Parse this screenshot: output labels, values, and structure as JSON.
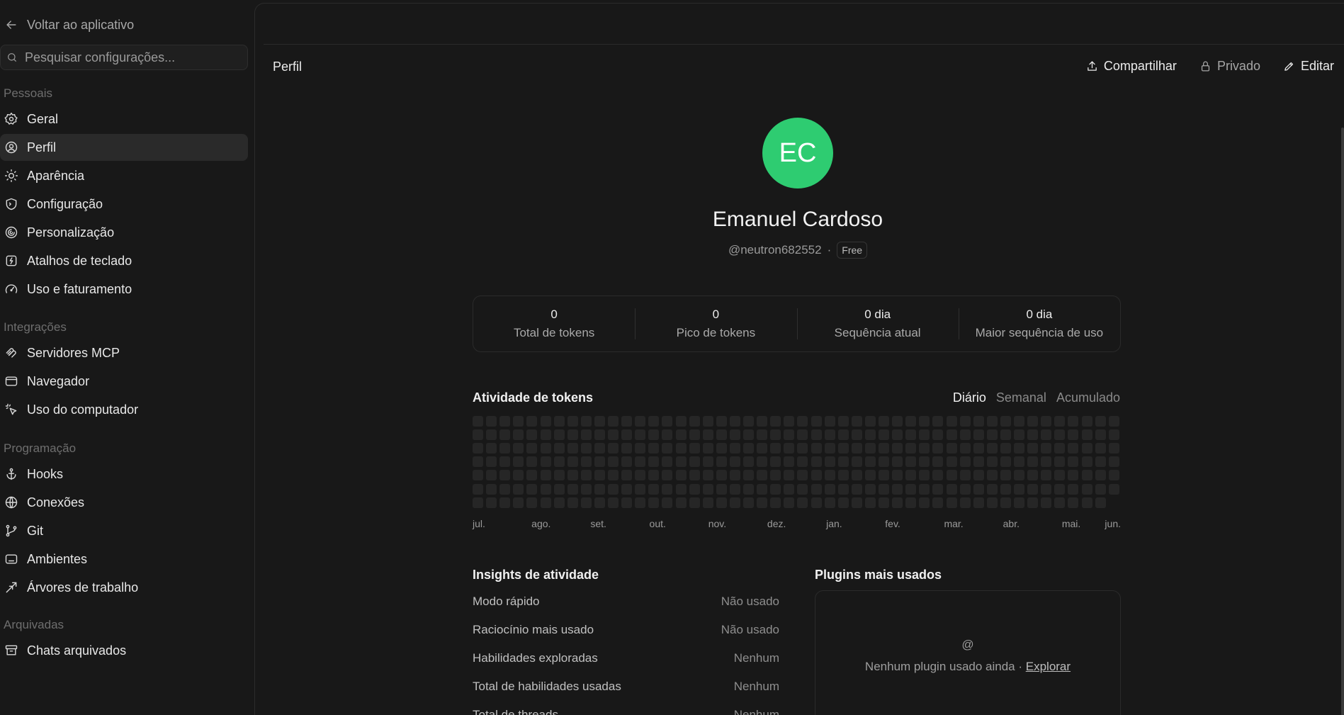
{
  "sidebar": {
    "back_label": "Voltar ao aplicativo",
    "search_placeholder": "Pesquisar configurações...",
    "sections": [
      {
        "title": "Pessoais",
        "items": [
          {
            "label": "Geral",
            "icon": "gear-icon"
          },
          {
            "label": "Perfil",
            "icon": "user-circle-icon",
            "active": true
          },
          {
            "label": "Aparência",
            "icon": "sun-icon"
          },
          {
            "label": "Configuração",
            "icon": "terminal-shield-icon"
          },
          {
            "label": "Personalização",
            "icon": "swirl-icon"
          },
          {
            "label": "Atalhos de teclado",
            "icon": "keyboard-shortcut-icon"
          },
          {
            "label": "Uso e faturamento",
            "icon": "gauge-icon"
          }
        ]
      },
      {
        "title": "Integrações",
        "items": [
          {
            "label": "Servidores MCP",
            "icon": "mcp-icon"
          },
          {
            "label": "Navegador",
            "icon": "browser-window-icon"
          },
          {
            "label": "Uso do computador",
            "icon": "cursor-click-icon"
          }
        ]
      },
      {
        "title": "Programação",
        "items": [
          {
            "label": "Hooks",
            "icon": "anchor-icon"
          },
          {
            "label": "Conexões",
            "icon": "globe-icon"
          },
          {
            "label": "Git",
            "icon": "git-branch-icon"
          },
          {
            "label": "Ambientes",
            "icon": "laptop-icon"
          },
          {
            "label": "Árvores de trabalho",
            "icon": "worktree-icon"
          }
        ]
      },
      {
        "title": "Arquivadas",
        "items": [
          {
            "label": "Chats arquivados",
            "icon": "archive-box-icon"
          }
        ]
      }
    ]
  },
  "header": {
    "title": "Perfil",
    "share_label": "Compartilhar",
    "private_label": "Privado",
    "edit_label": "Editar"
  },
  "profile": {
    "initials": "EC",
    "avatar_color": "#2ecc71",
    "name": "Emanuel Cardoso",
    "handle": "@neutron682552",
    "separator": "·",
    "plan": "Free"
  },
  "stats": [
    {
      "value": "0",
      "label": "Total de tokens"
    },
    {
      "value": "0",
      "label": "Pico de tokens"
    },
    {
      "value": "0 dia",
      "label": "Sequência atual"
    },
    {
      "value": "0 dia",
      "label": "Maior sequência de uso"
    }
  ],
  "activity": {
    "title": "Atividade de tokens",
    "tabs": [
      {
        "label": "Diário",
        "active": true
      },
      {
        "label": "Semanal",
        "active": false
      },
      {
        "label": "Acumulado",
        "active": false
      }
    ],
    "months": [
      "jul.",
      "ago.",
      "set.",
      "out.",
      "nov.",
      "dez.",
      "jan.",
      "fev.",
      "mar.",
      "abr.",
      "mai.",
      "jun."
    ]
  },
  "insights": {
    "title": "Insights de atividade",
    "rows": [
      {
        "label": "Modo rápido",
        "value": "Não usado"
      },
      {
        "label": "Raciocínio mais usado",
        "value": "Não usado"
      },
      {
        "label": "Habilidades exploradas",
        "value": "Nenhum"
      },
      {
        "label": "Total de habilidades usadas",
        "value": "Nenhum"
      },
      {
        "label": "Total de threads",
        "value": "Nenhum"
      }
    ]
  },
  "plugins": {
    "title": "Plugins mais usados",
    "icon_glyph": "@",
    "empty_text": "Nenhum plugin usado ainda · ",
    "explore_label": "Explorar"
  }
}
